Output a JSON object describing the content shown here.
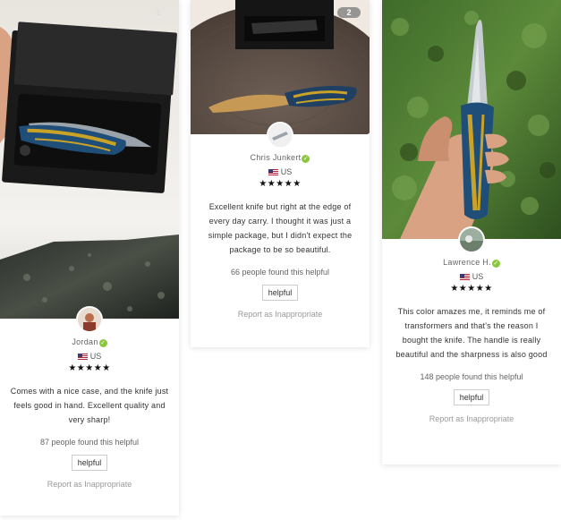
{
  "reviews": [
    {
      "image_count": "2",
      "name": "Jordan",
      "country": "US",
      "stars": "★★★★★",
      "text": "Comes with a nice case, and the knife just feels good in hand. Excellent quality and very sharp!",
      "helpful_count": "87 people found this helpful",
      "helpful_label": "helpful",
      "report_label": "Report as Inappropriate"
    },
    {
      "image_count": "2",
      "name": "Chris Junkert",
      "country": "US",
      "stars": "★★★★★",
      "text": "Excellent knife but right at the edge of every day carry. I thought it was just a simple package, but I didn't expect the package to be so beautiful.",
      "helpful_count": "66 people found this helpful",
      "helpful_label": "helpful",
      "report_label": "Report as Inappropriate"
    },
    {
      "name": "Lawrence H.",
      "country": "US",
      "stars": "★★★★★",
      "text": "This color amazes me, it reminds me of transformers and that's the reason I bought the knife. The handle is really beautiful and the sharpness is also good",
      "helpful_count": "148 people found this helpful",
      "helpful_label": "helpful",
      "report_label": "Report as Inappropriate"
    }
  ],
  "colors": {
    "verified": "#8cc63f",
    "handle_blue": "#1f4e79",
    "handle_gold": "#c9a227"
  },
  "icons": {
    "verified": "check-badge-icon",
    "flag": "us-flag-icon",
    "star": "star-icon"
  }
}
